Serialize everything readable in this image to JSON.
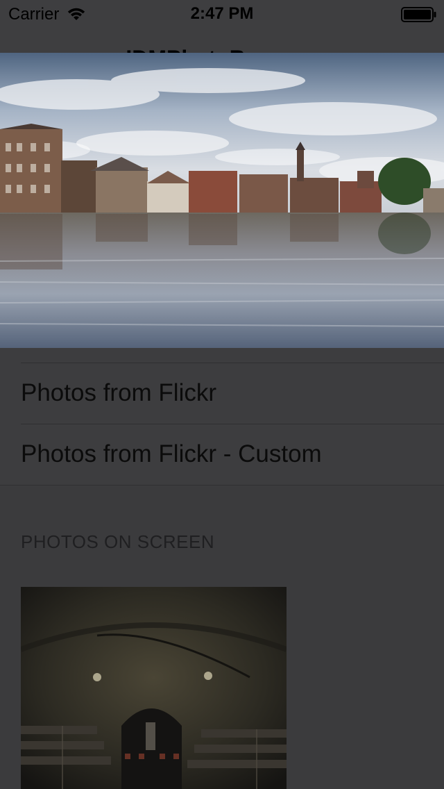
{
  "status_bar": {
    "carrier": "Carrier",
    "time": "2:47 PM",
    "wifi_icon": "wifi-icon",
    "battery_icon": "battery-icon"
  },
  "nav": {
    "title": "IDMPhotoBrowser"
  },
  "photos_table": {
    "rows": [
      {
        "label": "Photos from Flickr"
      },
      {
        "label": "Photos from Flickr - Custom"
      }
    ]
  },
  "photos_on_screen": {
    "header": "PHOTOS ON SCREEN"
  },
  "colors": {
    "background": "#3b3b3d",
    "text": "#000000",
    "separator": "#2f2f31"
  }
}
